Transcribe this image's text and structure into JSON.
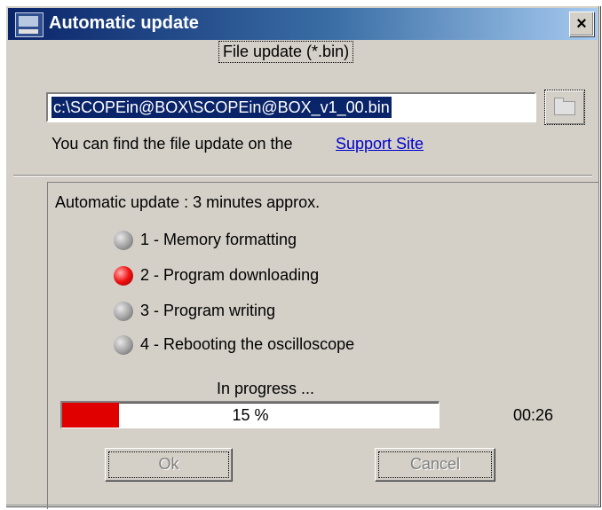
{
  "window": {
    "title": "Automatic update",
    "close_glyph": "×",
    "app_icon": "oscilloscope-app-icon"
  },
  "file_update": {
    "label": "File update (*.bin)",
    "path_value": "c:\\SCOPEin@BOX\\SCOPEin@BOX_v1_00.bin",
    "browse_icon": "folder-icon",
    "support_text": "You can find the file update on the",
    "support_link": "Support Site"
  },
  "update": {
    "description": "Automatic update : 3 minutes approx.",
    "steps": [
      {
        "label": "1 - Memory formatting",
        "status": "inactive",
        "color": "#a0a0a0"
      },
      {
        "label": "2 - Program downloading",
        "status": "active",
        "color": "#f01010"
      },
      {
        "label": "3 - Program writing",
        "status": "inactive",
        "color": "#a0a0a0"
      },
      {
        "label": "4 - Rebooting the oscilloscope",
        "status": "inactive",
        "color": "#a0a0a0"
      }
    ],
    "progress_label": "In progress ...",
    "progress_percent": 15,
    "progress_text": "15 %",
    "progress_color": "#e00000",
    "timer": "00:26"
  },
  "buttons": {
    "ok_label": "Ok",
    "cancel_label": "Cancel"
  }
}
